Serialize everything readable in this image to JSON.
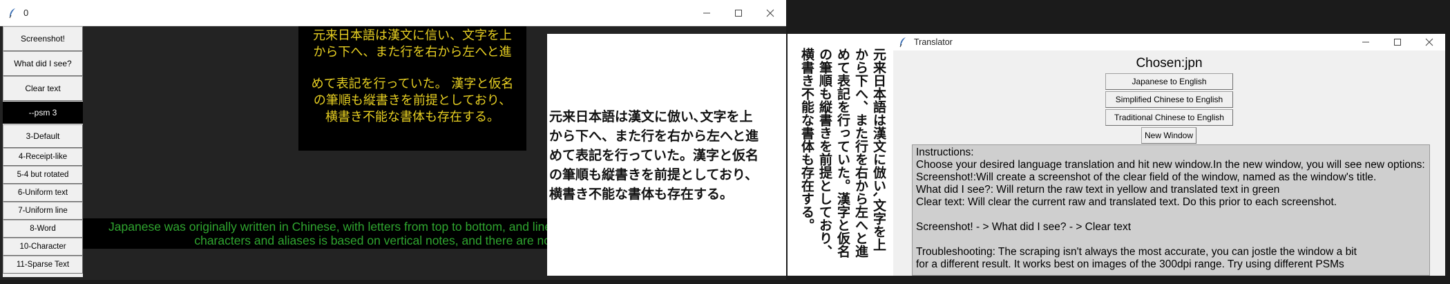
{
  "main_window": {
    "title": "0",
    "sidebar": {
      "screenshot": "Screenshot!",
      "what_did_i_see": "What did I see?",
      "clear_text": "Clear text",
      "psm_label": "--psm 3",
      "psm_options": [
        "3-Default",
        "4-Receipt-like",
        "5-4 but rotated",
        "6-Uniform text",
        "7-Uniform line",
        "8-Word",
        "10-Character",
        "11-Sparse Text"
      ]
    },
    "raw_text_lines": [
      "元来日本語は漢文に信い、文字を上",
      "から下へ、また行を右から左へと進",
      "めて表記を行っていた。 漢字と仮名",
      "の筆順も縦書きを前提としており、",
      "横書き不能な書体も存在する。"
    ],
    "translated_lines": [
      "Japanese was originally written in Chinese, with letters from top to bottom, and lines from right to left. The order of",
      "characters and aliases is based on vertical notes, and there are non-verbal forms."
    ]
  },
  "source_image": {
    "lines": [
      "元来日本語は漢文に倣い､文字を上",
      "から下へ、また行を右から左へと進",
      "めて表記を行っていた。漢字と仮名",
      "の筆順も縦書きを前提としており、",
      "横書き不能な書体も存在する。"
    ]
  },
  "vertical_image": {
    "lines": [
      "元来日本語は漢文に倣い､文字を上",
      "から下へ、また行を右から左へと進",
      "めて表記を行っていた。漢字と仮名",
      "の筆順も縦書きを前提としており、",
      "横書き不能な書体も存在する。"
    ]
  },
  "translator_window": {
    "title": "Translator",
    "chosen": "Chosen:jpn",
    "buttons": [
      "Japanese to English",
      "Simplified Chinese to English",
      "Traditional Chinese to English"
    ],
    "new_window": "New Window",
    "instructions": {
      "header": "Instructions:",
      "line1": "Choose your desired language translation and hit new window.In the new window, you will see new options:",
      "line2": "Screenshot!:Will create a screenshot of the clear field of the window, named as the window's title.",
      "line3": "What did I see?: Will return the raw text in yellow and translated text in green",
      "line4": "Clear text: Will clear the current raw and translated text. Do this prior to each screenshot.",
      "line5": "Screenshot! - > What did I see? - > Clear text",
      "line6": "Troubleshooting: The scraping isn't always the most accurate, you can jostle the window a bit",
      "line7": "for a different result. It works best on images of the 300dpi range. Try using different PSMs"
    }
  },
  "colors": {
    "raw_text": "#e8d022",
    "translated_text": "#2fa52f",
    "main_bg": "#232323",
    "psm_label_bg": "#000000"
  }
}
